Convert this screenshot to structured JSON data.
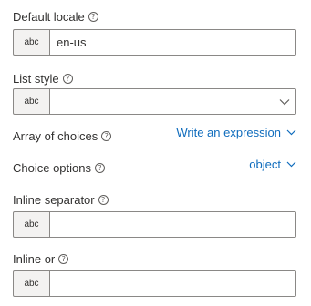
{
  "fields": {
    "default_locale": {
      "label": "Default locale",
      "type_badge": "abc",
      "value": "en-us"
    },
    "list_style": {
      "label": "List style",
      "type_badge": "abc",
      "value": ""
    },
    "array_of_choices": {
      "label": "Array of choices",
      "action": "Write an expression"
    },
    "choice_options": {
      "label": "Choice options",
      "action": "object"
    },
    "inline_separator": {
      "label": "Inline separator",
      "type_badge": "abc",
      "value": ""
    },
    "inline_or": {
      "label": "Inline or",
      "type_badge": "abc",
      "value": ""
    }
  },
  "icons": {
    "info": "?",
    "chevron": "chevron-down-icon"
  },
  "colors": {
    "link": "#0f6cbd",
    "border": "#8a8886",
    "badge_bg": "#f3f2f1",
    "text": "#323130"
  }
}
